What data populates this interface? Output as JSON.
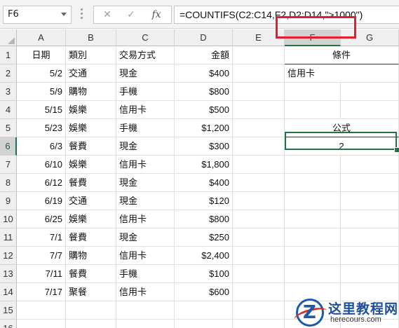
{
  "name_box": "F6",
  "formula_bar": {
    "cancel": "✕",
    "enter": "✓",
    "fx": "fx",
    "formula": "=COUNTIFS(C2:C14,F2,D2:D14,\">1000\")"
  },
  "columns": [
    "A",
    "B",
    "C",
    "D",
    "E",
    "F",
    "G"
  ],
  "rows": [
    "1",
    "2",
    "3",
    "4",
    "5",
    "6",
    "7",
    "8",
    "9",
    "10",
    "11",
    "12",
    "13",
    "14",
    "15",
    "16"
  ],
  "headers": {
    "A": "日期",
    "B": "類別",
    "C": "交易方式",
    "D": "金額",
    "F": "條件"
  },
  "table": [
    {
      "date": "5/2",
      "category": "交通",
      "method": "現金",
      "amount": "$400"
    },
    {
      "date": "5/9",
      "category": "購物",
      "method": "手機",
      "amount": "$800"
    },
    {
      "date": "5/15",
      "category": "娛樂",
      "method": "信用卡",
      "amount": "$500"
    },
    {
      "date": "5/23",
      "category": "娛樂",
      "method": "手機",
      "amount": "$1,200"
    },
    {
      "date": "6/3",
      "category": "餐費",
      "method": "現金",
      "amount": "$300"
    },
    {
      "date": "6/10",
      "category": "娛樂",
      "method": "信用卡",
      "amount": "$1,800"
    },
    {
      "date": "6/12",
      "category": "餐費",
      "method": "現金",
      "amount": "$400"
    },
    {
      "date": "6/19",
      "category": "交通",
      "method": "現金",
      "amount": "$120"
    },
    {
      "date": "6/25",
      "category": "娛樂",
      "method": "信用卡",
      "amount": "$800"
    },
    {
      "date": "7/1",
      "category": "餐費",
      "method": "現金",
      "amount": "$250"
    },
    {
      "date": "7/7",
      "category": "購物",
      "method": "信用卡",
      "amount": "$2,400"
    },
    {
      "date": "7/11",
      "category": "餐費",
      "method": "手機",
      "amount": "$100"
    },
    {
      "date": "7/17",
      "category": "聚餐",
      "method": "信用卡",
      "amount": "$600"
    }
  ],
  "criteria": {
    "F2": "信用卡",
    "F5": "公式",
    "F6": "2"
  },
  "watermark": {
    "logo_letter": "Z",
    "title": "这里教程网",
    "url": "herecours.com"
  },
  "colors": {
    "selection": "#217346",
    "highlight_box": "#e01e2d"
  }
}
